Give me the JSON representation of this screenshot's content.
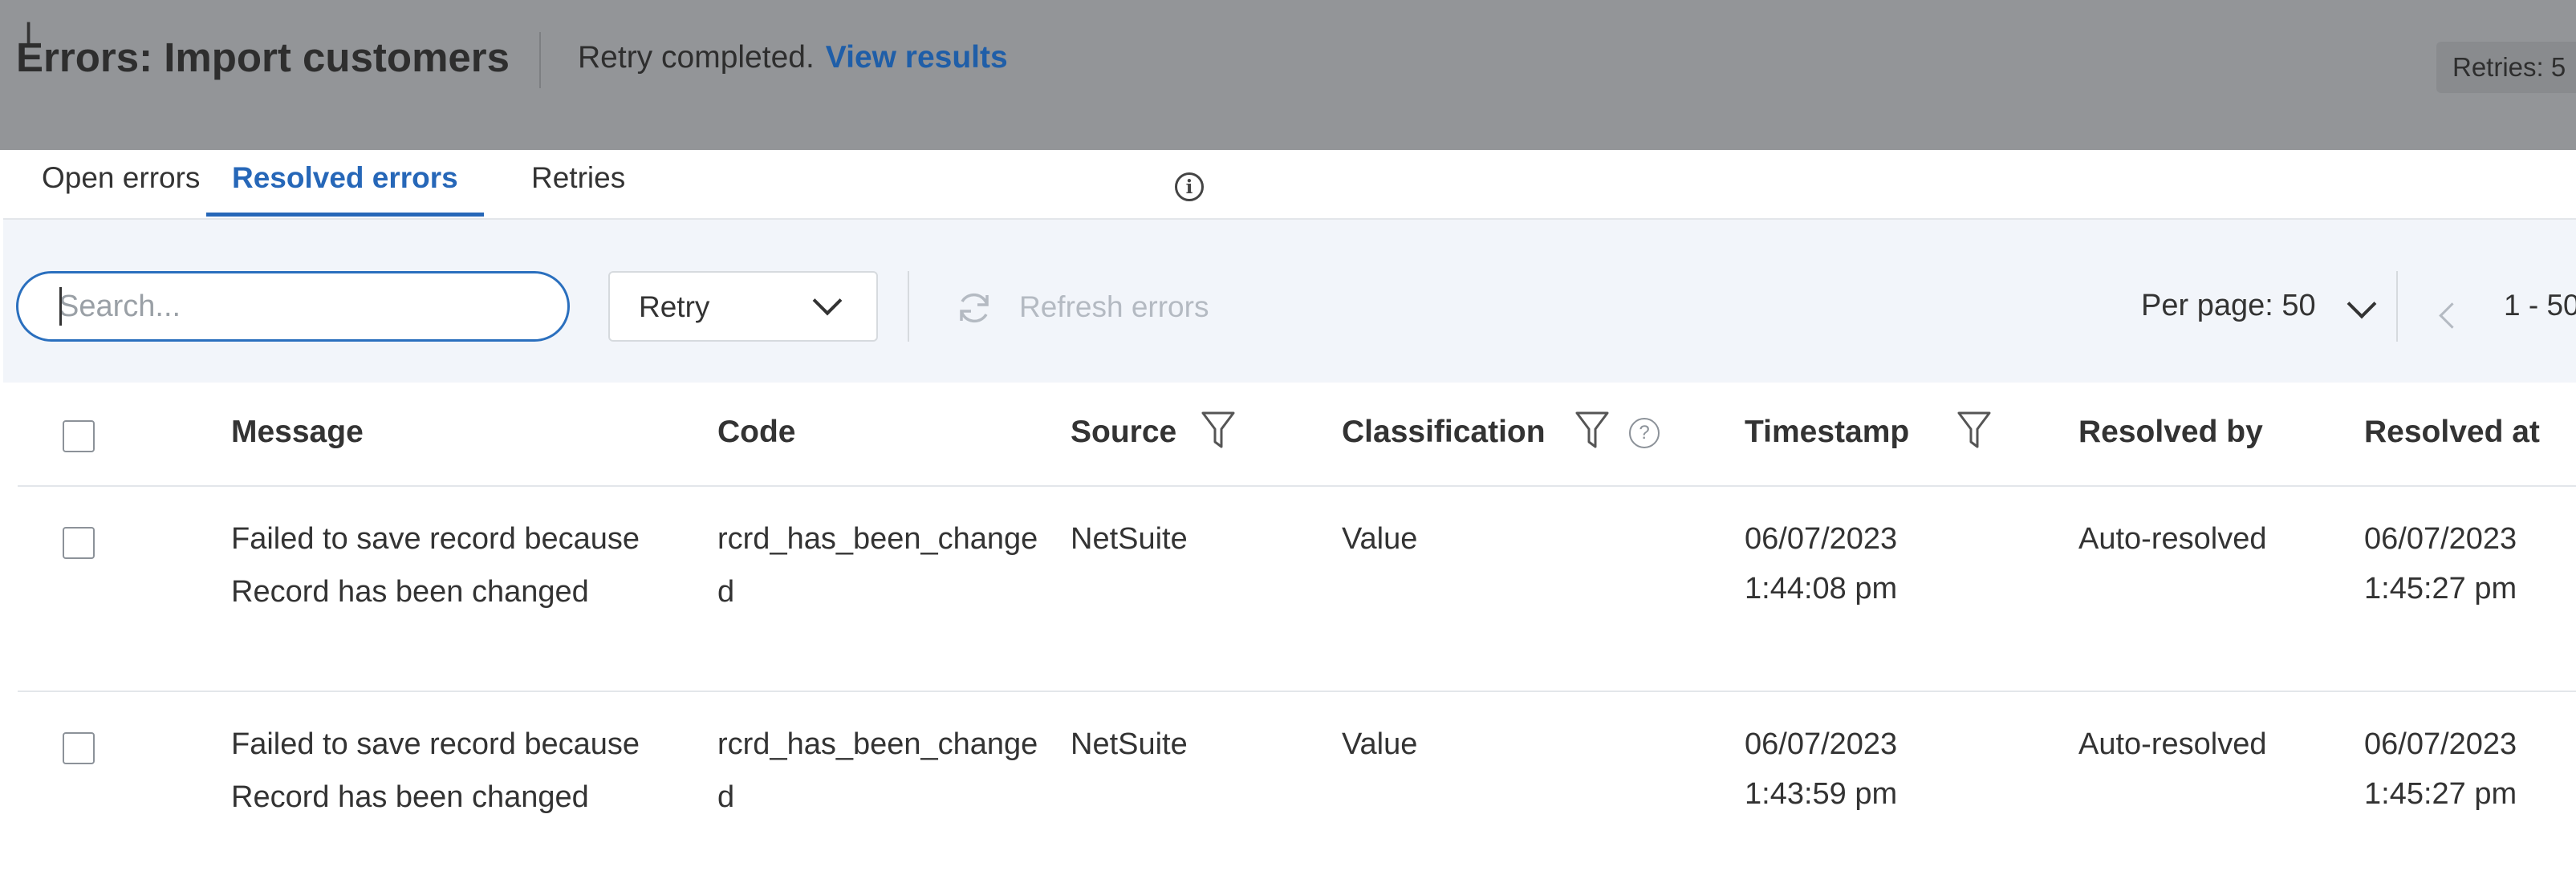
{
  "header": {
    "title": "Errors: Import customers",
    "status_text": "Retry completed.",
    "status_link": "View results",
    "retries_badge": "Retries: 5"
  },
  "tabs": [
    {
      "label": "Open errors",
      "active": false
    },
    {
      "label": "Resolved errors",
      "active": true
    },
    {
      "label": "Retries",
      "active": false,
      "icon": "info-icon"
    }
  ],
  "toolbar": {
    "search_placeholder": "Search...",
    "search_value": "",
    "retry_select_value": "Retry",
    "refresh_label": "Refresh errors",
    "per_page_label": "Per page: 50",
    "range_label": "1 - 50"
  },
  "table": {
    "columns": {
      "message": "Message",
      "code": "Code",
      "source": "Source",
      "classification": "Classification",
      "timestamp": "Timestamp",
      "resolved_by": "Resolved by",
      "resolved_at": "Resolved at"
    },
    "rows": [
      {
        "message": "Failed to save record because Record has been changed",
        "code": "rcrd_has_been_changed",
        "source": "NetSuite",
        "classification": "Value",
        "timestamp_date": "06/07/2023",
        "timestamp_time": "1:44:08 pm",
        "resolved_by": "Auto-resolved",
        "resolved_at_date": "06/07/2023",
        "resolved_at_time": "1:45:27 pm"
      },
      {
        "message": "Failed to save record because Record has been changed",
        "code": "rcrd_has_been_changed",
        "source": "NetSuite",
        "classification": "Value",
        "timestamp_date": "06/07/2023",
        "timestamp_time": "1:43:59 pm",
        "resolved_by": "Auto-resolved",
        "resolved_at_date": "06/07/2023",
        "resolved_at_time": "1:45:27 pm"
      }
    ]
  },
  "colors": {
    "accent": "#2667b8",
    "overlay": "#939598",
    "toolbar_bg": "#f2f5fa"
  }
}
